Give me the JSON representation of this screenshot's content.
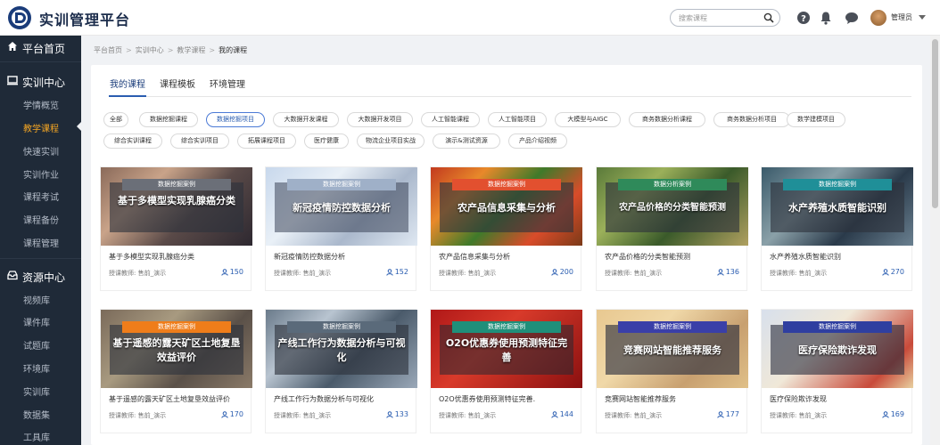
{
  "app": {
    "title": "实训管理平台"
  },
  "header": {
    "search_placeholder": "搜索课程",
    "user_name": "管理员"
  },
  "sidebar": {
    "home": "平台首页",
    "training": {
      "label": "实训中心",
      "items": [
        "学情概览",
        "教学课程",
        "快速实训",
        "实训作业",
        "课程考试",
        "课程备份",
        "课程管理"
      ],
      "active": "教学课程"
    },
    "resources": {
      "label": "资源中心",
      "items": [
        "视频库",
        "课件库",
        "试题库",
        "环境库",
        "实训库",
        "数据集",
        "工具库"
      ]
    }
  },
  "breadcrumb": [
    "平台首页",
    "实训中心",
    "教学课程",
    "我的课程"
  ],
  "tabs": [
    "我的课程",
    "课程模板",
    "环境管理"
  ],
  "filters": {
    "row1": [
      "全部",
      "数据挖掘课程",
      "数据挖掘项目",
      "大数据开发课程",
      "大数据开发项目",
      "人工智能课程",
      "人工智能项目",
      "大模型与AIGC",
      "商务数据分析课程",
      "商务数据分析项目",
      "数学建模项目"
    ],
    "row2": [
      "综合实训课程",
      "综合实训项目",
      "拓展课程项目",
      "医疗健康",
      "物流企业项目实战",
      "演示&测试资源",
      "产品介绍视频"
    ],
    "active": "数据挖掘项目"
  },
  "cards": [
    {
      "badge": "数据挖掘案例",
      "thumb_title": "基于多模型实现乳腺癌分类",
      "name": "基于多模型实现乳腺癌分类",
      "teacher": "授课教师: 售前_演示",
      "views": "150",
      "badge_color": "#6b6f78"
    },
    {
      "badge": "数据挖掘案例",
      "thumb_title": "新冠疫情防控数据分析",
      "name": "新冠疫情防控数据分析",
      "teacher": "授课教师: 售前_演示",
      "views": "152",
      "badge_color": "#9fb0c8"
    },
    {
      "badge": "数据挖掘案例",
      "thumb_title": "农产品信息采集与分析",
      "name": "农产品信息采集与分析",
      "teacher": "授课教师: 售前_演示",
      "views": "200",
      "badge_color": "#e2502f"
    },
    {
      "badge": "数据分析案例",
      "thumb_title": "农产品价格的分类智能预测",
      "name": "农产品价格的分类智能预测",
      "teacher": "授课教师: 售前_演示",
      "views": "136",
      "badge_color": "#2f8a5a"
    },
    {
      "badge": "数据挖掘案例",
      "thumb_title": "水产养殖水质智能识别",
      "name": "水产养殖水质智能识别",
      "teacher": "授课教师: 售前_演示",
      "views": "270",
      "badge_color": "#1f8f98"
    },
    {
      "badge": "数据挖掘案例",
      "thumb_title": "基于遥感的露天矿区土地复垦效益评价",
      "name": "基于遥感的露天矿区土地复垦效益评价",
      "teacher": "授课教师: 售前_演示",
      "views": "170",
      "badge_color": "#ef7d1a"
    },
    {
      "badge": "数据挖掘案例",
      "thumb_title": "产线工作行为数据分析与可视化",
      "name": "产线工作行为数据分析与可视化",
      "teacher": "授课教师: 售前_演示",
      "views": "133",
      "badge_color": "#5a6a7a"
    },
    {
      "badge": "数据挖掘案例",
      "thumb_title": "O2O优惠券使用预测特征完善",
      "name": "O2O优惠券使用预测特征完善.",
      "teacher": "授课教师: 售前_演示",
      "views": "144",
      "badge_color": "#1f8f7a"
    },
    {
      "badge": "数据挖掘案例",
      "thumb_title": "竞赛网站智能推荐服务",
      "name": "竞赛网站智能推荐服务",
      "teacher": "授课教师: 售前_演示",
      "views": "177",
      "badge_color": "#3a3fa8"
    },
    {
      "badge": "数据挖掘案例",
      "thumb_title": "医疗保险欺诈发现",
      "name": "医疗保险欺诈发现",
      "teacher": "授课教师: 售前_演示",
      "views": "169",
      "badge_color": "#2f3fa0"
    }
  ],
  "colors": {
    "sidebar_bg": "#1f2a38",
    "active_menu": "#f5a623",
    "accent": "#2a5db0"
  }
}
